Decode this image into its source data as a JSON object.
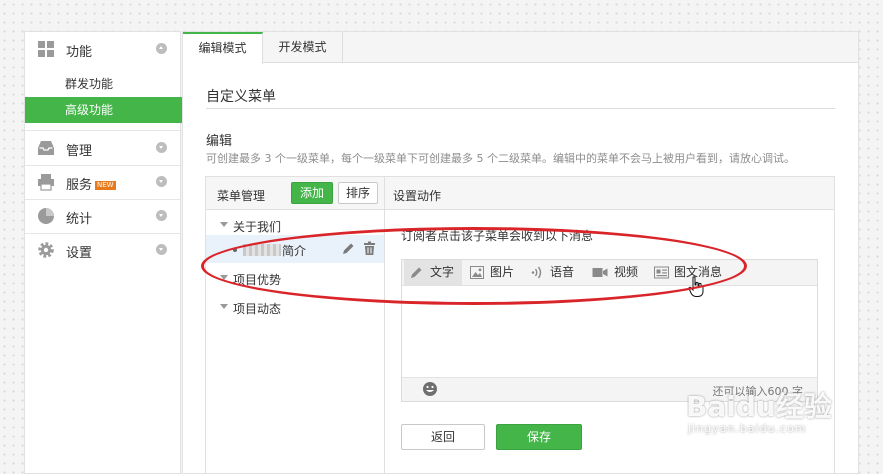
{
  "sidebar": {
    "groups": [
      {
        "label": "功能",
        "icon": "grid-icon"
      },
      {
        "label": "管理",
        "icon": "inbox-icon"
      },
      {
        "label": "服务",
        "icon": "printer-icon",
        "badge": "NEW"
      },
      {
        "label": "统计",
        "icon": "pie-chart-icon"
      },
      {
        "label": "设置",
        "icon": "gear-icon"
      }
    ],
    "sub_items": [
      {
        "label": "群发功能"
      },
      {
        "label": "高级功能"
      }
    ]
  },
  "tabs": [
    {
      "label": "编辑模式"
    },
    {
      "label": "开发模式"
    }
  ],
  "page": {
    "title": "自定义菜单",
    "section_title": "编辑",
    "tip": "可创建最多 3 个一级菜单，每个一级菜单下可创建最多 5 个二级菜单。编辑中的菜单不会马上被用户看到，请放心调试。"
  },
  "menu_manager": {
    "title": "菜单管理",
    "add_label": "添加",
    "sort_label": "排序",
    "items": [
      {
        "label": "关于我们"
      },
      {
        "label": "简介"
      },
      {
        "label": "项目优势"
      },
      {
        "label": "项目动态"
      }
    ]
  },
  "action": {
    "title": "设置动作",
    "message_label": "订阅者点击该子菜单会收到以下消息",
    "editor_tabs": [
      {
        "label": "文字",
        "icon": "pencil-icon"
      },
      {
        "label": "图片",
        "icon": "image-icon"
      },
      {
        "label": "语音",
        "icon": "sound-icon"
      },
      {
        "label": "视频",
        "icon": "video-icon"
      },
      {
        "label": "图文消息",
        "icon": "news-icon"
      }
    ],
    "counter": "还可以输入600 字",
    "back_label": "返回",
    "save_label": "保存"
  },
  "watermark": {
    "brand": "Baidu经验",
    "url": "jingyan.baidu.com"
  },
  "colors": {
    "accent": "#44b549",
    "annotation": "#d9252a",
    "selected_row": "#e9f1fb"
  }
}
